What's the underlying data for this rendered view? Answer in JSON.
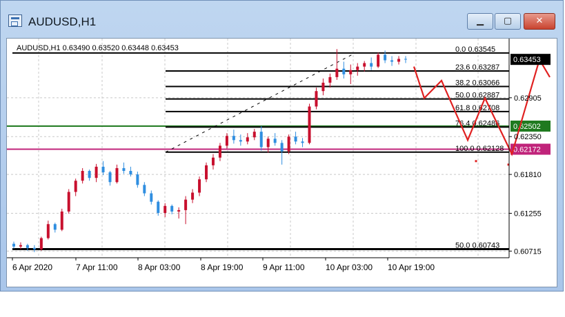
{
  "window": {
    "title": "AUDUSD,H1",
    "buttons": {
      "minimize_symbol": "▁",
      "maximize_symbol": "▢",
      "close_symbol": "✕"
    }
  },
  "chart_data": {
    "type": "candlestick",
    "info_line": "AUDUSD,H1  0.63490 0.63520 0.63448 0.63453",
    "y_scale": {
      "min": 0.6062,
      "max": 0.6375
    },
    "y_ticks": [
      "0.62905",
      "0.62350",
      "0.61810",
      "0.61255",
      "0.60715"
    ],
    "x_ticks": [
      "6 Apr 2020",
      "7 Apr 11:00",
      "8 Apr 03:00",
      "8 Apr 19:00",
      "9 Apr 11:00",
      "10 Apr 03:00",
      "10 Apr 19:00"
    ],
    "current_price": "0.63453",
    "horizontal_lines": [
      {
        "price": 0.625,
        "label": "0.62502",
        "color": "#1f7a1f"
      },
      {
        "price": 0.6217,
        "label": "0.62172",
        "color": "#c0237a"
      }
    ],
    "fibonacci": [
      {
        "level": "0.0",
        "price": 0.63545,
        "label": "0.0  0.63545"
      },
      {
        "level": "23.6",
        "price": 0.63287,
        "label": "23.6  0.63287"
      },
      {
        "level": "38.2",
        "price": 0.63066,
        "label": "38.2  0.63066"
      },
      {
        "level": "50.0",
        "price": 0.62887,
        "label": "50.0  0.62887"
      },
      {
        "level": "61.8",
        "price": 0.62708,
        "label": "61.8  0.62708"
      },
      {
        "level": "76.4",
        "price": 0.62486,
        "label": "76.4  0.62486"
      },
      {
        "level": "100.0",
        "price": 0.62128,
        "label": "100.0  0.62128"
      },
      {
        "level": "50.0",
        "price": 0.60743,
        "label": "50.0  0.60743"
      }
    ],
    "candles": [
      [
        0.6082,
        0.6085,
        0.6075,
        0.6078
      ],
      [
        0.6078,
        0.6084,
        0.6074,
        0.608
      ],
      [
        0.608,
        0.6082,
        0.6072,
        0.6076
      ],
      [
        0.6076,
        0.608,
        0.607,
        0.6074
      ],
      [
        0.6074,
        0.6092,
        0.6072,
        0.609
      ],
      [
        0.609,
        0.6115,
        0.6088,
        0.611
      ],
      [
        0.611,
        0.6112,
        0.6098,
        0.6102
      ],
      [
        0.6102,
        0.6132,
        0.61,
        0.6128
      ],
      [
        0.6128,
        0.616,
        0.6125,
        0.6156
      ],
      [
        0.6156,
        0.6175,
        0.615,
        0.6172
      ],
      [
        0.6172,
        0.619,
        0.6168,
        0.6186
      ],
      [
        0.6186,
        0.6188,
        0.6172,
        0.6176
      ],
      [
        0.6176,
        0.6196,
        0.617,
        0.6192
      ],
      [
        0.6192,
        0.62,
        0.618,
        0.6184
      ],
      [
        0.6184,
        0.6186,
        0.6165,
        0.617
      ],
      [
        0.617,
        0.6195,
        0.6168,
        0.619
      ],
      [
        0.619,
        0.6198,
        0.6182,
        0.6186
      ],
      [
        0.6186,
        0.6192,
        0.6178,
        0.6181
      ],
      [
        0.6181,
        0.6185,
        0.6162,
        0.6166
      ],
      [
        0.6166,
        0.617,
        0.615,
        0.6154
      ],
      [
        0.6154,
        0.6158,
        0.6138,
        0.6142
      ],
      [
        0.6142,
        0.6144,
        0.6122,
        0.6126
      ],
      [
        0.6126,
        0.614,
        0.612,
        0.6136
      ],
      [
        0.6136,
        0.6138,
        0.6124,
        0.6128
      ],
      [
        0.6128,
        0.6134,
        0.6118,
        0.613
      ],
      [
        0.613,
        0.615,
        0.611,
        0.6145
      ],
      [
        0.6145,
        0.616,
        0.614,
        0.6155
      ],
      [
        0.6155,
        0.6178,
        0.615,
        0.6174
      ],
      [
        0.6174,
        0.6198,
        0.617,
        0.6194
      ],
      [
        0.6194,
        0.621,
        0.6188,
        0.6205
      ],
      [
        0.6205,
        0.6226,
        0.62,
        0.6222
      ],
      [
        0.6222,
        0.624,
        0.6218,
        0.6236
      ],
      [
        0.6236,
        0.6245,
        0.6225,
        0.623
      ],
      [
        0.623,
        0.6238,
        0.6222,
        0.6228
      ],
      [
        0.6228,
        0.624,
        0.6224,
        0.6234
      ],
      [
        0.6234,
        0.6246,
        0.623,
        0.6242
      ],
      [
        0.6242,
        0.625,
        0.6215,
        0.622
      ],
      [
        0.622,
        0.6235,
        0.6212,
        0.6232
      ],
      [
        0.6232,
        0.624,
        0.6222,
        0.6226
      ],
      [
        0.6226,
        0.623,
        0.6195,
        0.6214
      ],
      [
        0.6214,
        0.6238,
        0.621,
        0.6235
      ],
      [
        0.6235,
        0.6242,
        0.6224,
        0.6228
      ],
      [
        0.6228,
        0.6233,
        0.622,
        0.6226
      ],
      [
        0.6226,
        0.6282,
        0.6224,
        0.6278
      ],
      [
        0.6278,
        0.6305,
        0.6274,
        0.63
      ],
      [
        0.63,
        0.6318,
        0.6294,
        0.6312
      ],
      [
        0.6312,
        0.6325,
        0.6305,
        0.632
      ],
      [
        0.632,
        0.636,
        0.6316,
        0.6332
      ],
      [
        0.6332,
        0.6342,
        0.6318,
        0.6324
      ],
      [
        0.6324,
        0.6338,
        0.631,
        0.633
      ],
      [
        0.633,
        0.634,
        0.6322,
        0.6335
      ],
      [
        0.6335,
        0.6343,
        0.6328,
        0.634
      ],
      [
        0.634,
        0.6348,
        0.633,
        0.6335
      ],
      [
        0.6335,
        0.6355,
        0.6333,
        0.6352
      ],
      [
        0.6352,
        0.6358,
        0.634,
        0.6344
      ],
      [
        0.6344,
        0.635,
        0.6336,
        0.6342
      ],
      [
        0.6342,
        0.635,
        0.6338,
        0.6346
      ],
      [
        0.6346,
        0.635,
        0.634,
        0.6345
      ]
    ],
    "projection_path": [
      [
        590,
        0.6335
      ],
      [
        605,
        0.629
      ],
      [
        630,
        0.6315
      ],
      [
        668,
        0.623
      ],
      [
        693,
        0.629
      ],
      [
        732,
        0.621
      ],
      [
        772,
        0.6345
      ],
      [
        787,
        0.632
      ]
    ],
    "red_dots": [
      [
        680,
        0.62
      ],
      [
        727,
        0.6195
      ],
      [
        804,
        0.6325
      ],
      [
        804,
        0.6292
      ]
    ]
  }
}
